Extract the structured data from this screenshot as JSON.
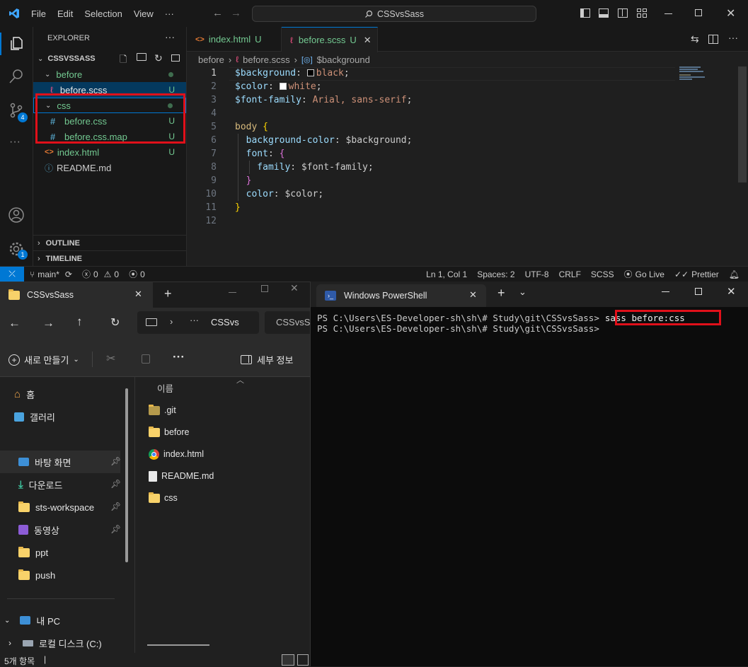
{
  "vscode": {
    "menu": [
      "File",
      "Edit",
      "Selection",
      "View",
      "···"
    ],
    "command_center": "CSSvsSass",
    "explorer": {
      "title": "EXPLORER",
      "more": "···",
      "root": "CSSVSSASS",
      "items": [
        {
          "label": "before",
          "status": ""
        },
        {
          "label": "before.scss",
          "status": "U"
        },
        {
          "label": "css",
          "status": ""
        },
        {
          "label": "before.css",
          "status": "U"
        },
        {
          "label": "before.css.map",
          "status": "U"
        },
        {
          "label": "index.html",
          "status": "U"
        },
        {
          "label": "README.md",
          "status": ""
        }
      ],
      "outline": "OUTLINE",
      "timeline": "TIMELINE"
    },
    "badges": {
      "source_control": "4",
      "settings": "1"
    },
    "tabs": [
      {
        "label": "index.html",
        "status": "U"
      },
      {
        "label": "before.scss",
        "status": "U"
      }
    ],
    "breadcrumb": {
      "folder": "before",
      "file": "before.scss",
      "symbol": "$background"
    },
    "code": {
      "line_numbers": [
        "1",
        "2",
        "3",
        "4",
        "5",
        "6",
        "7",
        "8",
        "9",
        "10",
        "11",
        "12"
      ],
      "l1_var": "$background",
      "l1_colon": ": ",
      "l1_val": "black",
      "l1_end": ";",
      "l2_var": "$color",
      "l2_colon": ": ",
      "l2_val": "white",
      "l2_end": ";",
      "l3_var": "$font-family",
      "l3_colon": ": ",
      "l3_val": "Arial, sans-serif",
      "l3_end": ";",
      "l5_sel": "body",
      "l5_brace": " {",
      "l6_prop": "  background-color",
      "l6_rest": ": $background;",
      "l7_prop": "  font",
      "l7_colon": ": ",
      "l7_brace": "{",
      "l8_prop": "    family",
      "l8_rest": ": $font-family;",
      "l9_brace": "  }",
      "l10_prop": "  color",
      "l10_rest": ": $color;",
      "l11_brace": "}"
    },
    "swatch_colors": {
      "black": "#000000",
      "white": "#ffffff"
    },
    "status": {
      "branch": "main*",
      "errors": "0",
      "warnings": "0",
      "ports": "0",
      "position": "Ln 1, Col 1",
      "spaces": "Spaces: 2",
      "encoding": "UTF-8",
      "eol": "CRLF",
      "language": "SCSS",
      "golive": "Go Live",
      "prettier": "Prettier"
    }
  },
  "file_explorer": {
    "tab_title": "CSSvsSass",
    "path_crumb1": "CSSvs",
    "path_crumb2": "CSSvsSa",
    "new_button": "새로 만들기",
    "details_button": "세부 정보",
    "column_name": "이름",
    "nav": [
      {
        "label": "홈"
      },
      {
        "label": "갤러리"
      },
      {
        "label": "바탕 화면"
      },
      {
        "label": "다운로드"
      },
      {
        "label": "sts-workspace"
      },
      {
        "label": "동영상"
      },
      {
        "label": "ppt"
      },
      {
        "label": "push"
      },
      {
        "label": "내 PC"
      },
      {
        "label": "로컬 디스크 (C:)"
      }
    ],
    "files": [
      ".git",
      "before",
      "index.html",
      "README.md",
      "css"
    ],
    "item_count": "5개 항목"
  },
  "terminal": {
    "tab_title": "Windows PowerShell",
    "prompt": "PS C:\\Users\\ES-Developer-sh\\sh\\# Study\\git\\CSSvsSass>",
    "command": "sass before:css"
  },
  "colors": {
    "accent": "#0078d4",
    "highlight": "#e0101a",
    "git_untracked": "#73c991"
  }
}
